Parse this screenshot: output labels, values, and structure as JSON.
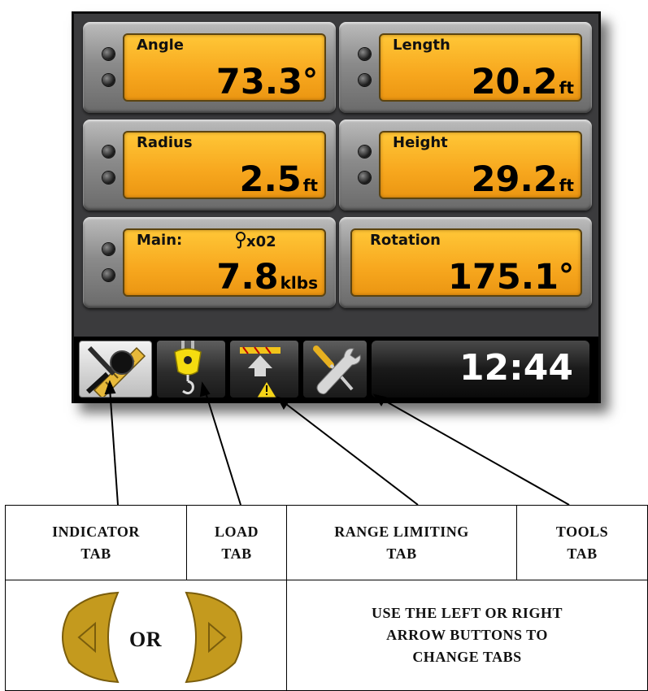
{
  "gauges": [
    {
      "label": "Angle",
      "value": "73.3",
      "unit": "°"
    },
    {
      "label": "Length",
      "value": "20.2",
      "unit": "ft"
    },
    {
      "label": "Radius",
      "value": "2.5",
      "unit": "ft"
    },
    {
      "label": "Height",
      "value": "29.2",
      "unit": "ft"
    },
    {
      "label": "Main:",
      "hook_count": "x02",
      "value": "7.8",
      "unit": "klbs"
    },
    {
      "label": "Rotation",
      "value": "175.1",
      "unit": "°"
    }
  ],
  "clock": "12:44",
  "tabs": {
    "indicator": "INDICATOR TAB",
    "load": "LOAD TAB",
    "range_limiting": "RANGE LIMITING TAB",
    "tools": "TOOLS TAB"
  },
  "legend": {
    "col1_line1": "INDICATOR",
    "col1_line2": "TAB",
    "col2_line1": "LOAD",
    "col2_line2": "TAB",
    "col3_line1": "RANGE LIMITING",
    "col3_line2": "TAB",
    "col4_line1": "TOOLS",
    "col4_line2": "TAB",
    "or_text": "OR",
    "instr_line1": "USE THE LEFT OR RIGHT",
    "instr_line2": "ARROW BUTTONS TO",
    "instr_line3": "CHANGE TABS"
  },
  "icons": {
    "indicator_tab": "ruler-magnifier-icon",
    "load_tab": "hook-block-icon",
    "range_tab": "range-limit-warning-icon",
    "tools_tab": "screwdriver-wrench-icon",
    "left_arrow": "left-arrow-button-icon",
    "right_arrow": "right-arrow-button-icon"
  },
  "colors": {
    "panel": "#f7a71e",
    "background": "#3b3b3d",
    "tab_bar": "#000000"
  }
}
